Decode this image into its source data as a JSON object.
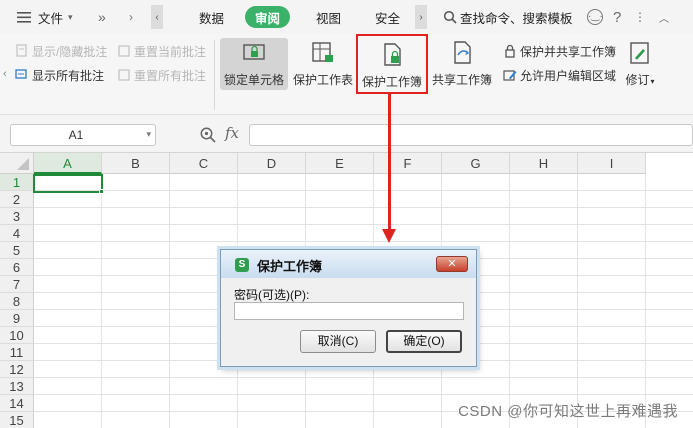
{
  "menubar": {
    "file_label": "文件",
    "more_label": "»",
    "tabs": [
      {
        "label": "数据"
      },
      {
        "label": "审阅"
      },
      {
        "label": "视图"
      },
      {
        "label": "安全"
      }
    ],
    "search_label": "查找命令、搜索模板"
  },
  "ribbon": {
    "left_group": {
      "show_hide_comment": "显示/隐藏批注",
      "show_all_comments": "显示所有批注",
      "reset_current_comment": "重置当前批注",
      "reset_all_comments": "重置所有批注"
    },
    "lock_cell": "锁定单元格",
    "protect_sheet": "保护工作表",
    "protect_workbook": "保护工作簿",
    "share_workbook": "共享工作簿",
    "protect_shared_workbook": "保护并共享工作簿",
    "allow_users_edit": "允许用户编辑区域",
    "track_changes": "修订"
  },
  "formula_bar": {
    "name_box_value": "A1",
    "fx_label": "fx"
  },
  "grid": {
    "columns": [
      "A",
      "B",
      "C",
      "D",
      "E",
      "F",
      "G",
      "H",
      "I"
    ],
    "rows": [
      "1",
      "2",
      "3",
      "4",
      "5",
      "6",
      "7",
      "8",
      "9",
      "10",
      "11",
      "12",
      "13",
      "14",
      "15"
    ],
    "active_cell": "A1"
  },
  "dialog": {
    "title": "保护工作簿",
    "password_label": "密码(可选)(P):",
    "cancel_label": "取消(C)",
    "ok_label": "确定(O)",
    "close_glyph": "✕"
  },
  "watermark": "CSDN @你可知这世上再难遇我",
  "colors": {
    "accent_green": "#3bb26a",
    "highlight_red": "#e0231f",
    "active_cell_green": "#1f8b3a"
  }
}
